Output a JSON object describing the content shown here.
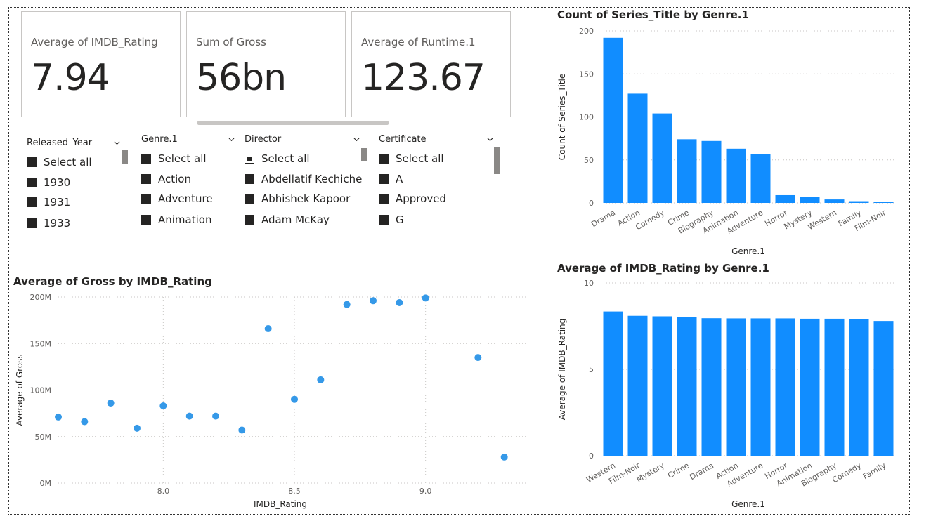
{
  "cards": [
    {
      "label": "Average of IMDB_Rating",
      "value": "7.94"
    },
    {
      "label": "Sum of Gross",
      "value": "56bn"
    },
    {
      "label": "Average of Runtime.1",
      "value": "123.67"
    }
  ],
  "slicers": [
    {
      "header": "Released_Year",
      "items": [
        "Select all",
        "1930",
        "1931",
        "1933"
      ]
    },
    {
      "header": "Genre.1",
      "items": [
        "Select all",
        "Action",
        "Adventure",
        "Animation"
      ]
    },
    {
      "header": "Director",
      "items": [
        "Select all",
        "Abdellatif Kechiche",
        "Abhishek Kapoor",
        "Adam McKay"
      ]
    },
    {
      "header": "Certificate",
      "items": [
        "Select all",
        "A",
        "Approved",
        "G"
      ]
    }
  ],
  "colors": {
    "bar": "#118dff",
    "point": "#3599e8",
    "grid": "#c8c6c4",
    "text": "#605e5c"
  },
  "chart_data": [
    {
      "type": "bar",
      "title": "Count of Series_Title by Genre.1",
      "xlabel": "Genre.1",
      "ylabel": "Count of Series_Title",
      "categories": [
        "Drama",
        "Action",
        "Comedy",
        "Crime",
        "Biography",
        "Animation",
        "Adventure",
        "Horror",
        "Mystery",
        "Western",
        "Family",
        "Film-Noir"
      ],
      "values": [
        192,
        127,
        104,
        74,
        72,
        63,
        57,
        9,
        7,
        4,
        2,
        1
      ],
      "ylim": [
        0,
        200
      ],
      "yticks": [
        "0",
        "50",
        "100",
        "150",
        "200"
      ],
      "grid": true
    },
    {
      "type": "bar",
      "title": "Average of IMDB_Rating by Genre.1",
      "xlabel": "Genre.1",
      "ylabel": "Average of IMDB_Rating",
      "categories": [
        "Western",
        "Film-Noir",
        "Mystery",
        "Crime",
        "Drama",
        "Action",
        "Adventure",
        "Horror",
        "Animation",
        "Biography",
        "Comedy",
        "Family"
      ],
      "values": [
        8.35,
        8.1,
        8.07,
        8.02,
        7.96,
        7.95,
        7.95,
        7.95,
        7.93,
        7.93,
        7.9,
        7.8
      ],
      "ylim": [
        0,
        10
      ],
      "yticks": [
        "0",
        "5",
        "10"
      ],
      "grid": true
    },
    {
      "type": "scatter",
      "title": "Average of Gross by IMDB_Rating",
      "xlabel": "IMDB_Rating",
      "ylabel": "Average of Gross",
      "x": [
        7.6,
        7.7,
        7.8,
        7.9,
        8.0,
        8.1,
        8.2,
        8.3,
        8.4,
        8.5,
        8.6,
        8.7,
        8.8,
        8.9,
        9.0,
        9.2,
        9.3
      ],
      "y": [
        71,
        66,
        86,
        59,
        83,
        72,
        72,
        57,
        166,
        90,
        111,
        192,
        196,
        194,
        199,
        135,
        28
      ],
      "xlim": [
        7.6,
        9.4
      ],
      "ylim": [
        0,
        200
      ],
      "xticks": [
        "8.0",
        "8.5",
        "9.0"
      ],
      "xtick_values": [
        8.0,
        8.5,
        9.0
      ],
      "yticks": [
        "0M",
        "50M",
        "100M",
        "150M",
        "200M"
      ],
      "grid": true
    }
  ]
}
